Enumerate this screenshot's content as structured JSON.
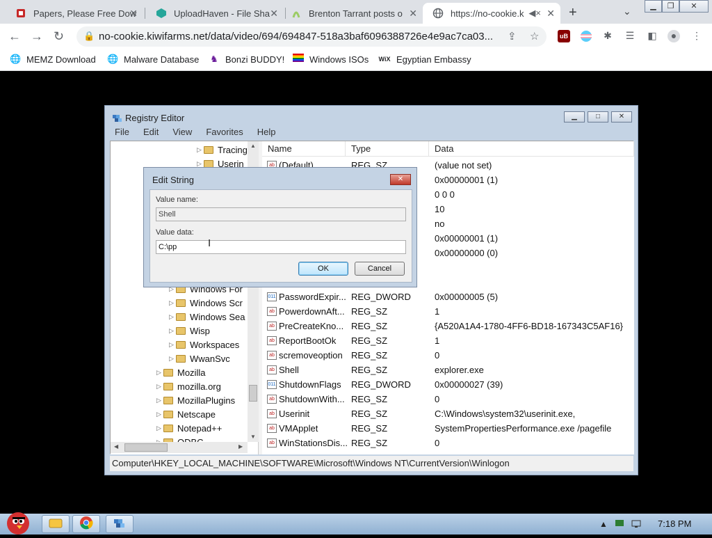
{
  "browser": {
    "tabs": [
      {
        "title": "Papers, Please Free Dow",
        "icon": "papers-please-icon"
      },
      {
        "title": "UploadHaven - File Sha",
        "icon": "uploadhaven-icon"
      },
      {
        "title": "Brenton Tarrant posts o",
        "icon": "kiwifarms-icon"
      },
      {
        "title": "https://no-cookie.k",
        "icon": "globe-icon"
      }
    ],
    "url": "no-cookie.kiwifarms.net/data/video/694/694847-518a3baf6096388726e4e9ac7ca03...",
    "bookmarks": [
      {
        "label": "MEMZ Download",
        "icon": "globe-icon"
      },
      {
        "label": "Malware Database",
        "icon": "globe-icon"
      },
      {
        "label": "Bonzi BUDDY!",
        "icon": "bonzi-icon"
      },
      {
        "label": "Windows ISOs",
        "icon": "rainbow-flag-icon"
      },
      {
        "label": "Egyptian Embassy",
        "icon": "wix-icon"
      }
    ],
    "wix_label": "WiX"
  },
  "regedit": {
    "title": "Registry Editor",
    "menu": [
      "File",
      "Edit",
      "View",
      "Favorites",
      "Help"
    ],
    "tree_items": [
      {
        "label": "Tracing",
        "indent": 4
      },
      {
        "label": "Userin",
        "indent": 4
      },
      {
        "label": "Windows For",
        "indent": 3
      },
      {
        "label": "Windows Scr",
        "indent": 3
      },
      {
        "label": "Windows Sea",
        "indent": 3
      },
      {
        "label": "Wisp",
        "indent": 3
      },
      {
        "label": "Workspaces",
        "indent": 3
      },
      {
        "label": "WwanSvc",
        "indent": 3
      },
      {
        "label": "Mozilla",
        "indent": 2
      },
      {
        "label": "mozilla.org",
        "indent": 2
      },
      {
        "label": "MozillaPlugins",
        "indent": 2
      },
      {
        "label": "Netscape",
        "indent": 2
      },
      {
        "label": "Notepad++",
        "indent": 2
      },
      {
        "label": "ODBC",
        "indent": 2
      }
    ],
    "columns": [
      "Name",
      "Type",
      "Data"
    ],
    "rows": [
      {
        "name": "(Default)",
        "type": "REG_SZ",
        "data": "(value not set)",
        "icon": "ab"
      },
      {
        "name": "",
        "type": "",
        "data": "0x00000001 (1)",
        "icon": ""
      },
      {
        "name": "",
        "type": "",
        "data": "0 0 0",
        "icon": ""
      },
      {
        "name": "",
        "type": "",
        "data": "10",
        "icon": ""
      },
      {
        "name": "",
        "type": "",
        "data": "no",
        "icon": ""
      },
      {
        "name": "",
        "type": "",
        "data": "0x00000001 (1)",
        "icon": ""
      },
      {
        "name": "",
        "type": "",
        "data": "0x00000000 (0)",
        "icon": ""
      },
      {
        "name": "",
        "type": "",
        "data": "",
        "icon": ""
      },
      {
        "name": "",
        "type": "",
        "data": "",
        "icon": ""
      },
      {
        "name": "PasswordExpir...",
        "type": "REG_DWORD",
        "data": "0x00000005 (5)",
        "icon": "dword"
      },
      {
        "name": "PowerdownAft...",
        "type": "REG_SZ",
        "data": "1",
        "icon": "ab"
      },
      {
        "name": "PreCreateKno...",
        "type": "REG_SZ",
        "data": "{A520A1A4-1780-4FF6-BD18-167343C5AF16}",
        "icon": "ab"
      },
      {
        "name": "ReportBootOk",
        "type": "REG_SZ",
        "data": "1",
        "icon": "ab"
      },
      {
        "name": "scremoveoption",
        "type": "REG_SZ",
        "data": "0",
        "icon": "ab"
      },
      {
        "name": "Shell",
        "type": "REG_SZ",
        "data": "explorer.exe",
        "icon": "ab"
      },
      {
        "name": "ShutdownFlags",
        "type": "REG_DWORD",
        "data": "0x00000027 (39)",
        "icon": "dword"
      },
      {
        "name": "ShutdownWith...",
        "type": "REG_SZ",
        "data": "0",
        "icon": "ab"
      },
      {
        "name": "Userinit",
        "type": "REG_SZ",
        "data": "C:\\Windows\\system32\\userinit.exe,",
        "icon": "ab"
      },
      {
        "name": "VMApplet",
        "type": "REG_SZ",
        "data": "SystemPropertiesPerformance.exe /pagefile",
        "icon": "ab"
      },
      {
        "name": "WinStationsDis...",
        "type": "REG_SZ",
        "data": "0",
        "icon": "ab"
      }
    ],
    "status_path": "Computer\\HKEY_LOCAL_MACHINE\\SOFTWARE\\Microsoft\\Windows NT\\CurrentVersion\\Winlogon"
  },
  "dialog": {
    "title": "Edit String",
    "value_name_label": "Value name:",
    "value_name": "Shell",
    "value_data_label": "Value data:",
    "value_data": "C:\\pp",
    "ok_label": "OK",
    "cancel_label": "Cancel"
  },
  "taskbar": {
    "clock": "7:18 PM"
  }
}
